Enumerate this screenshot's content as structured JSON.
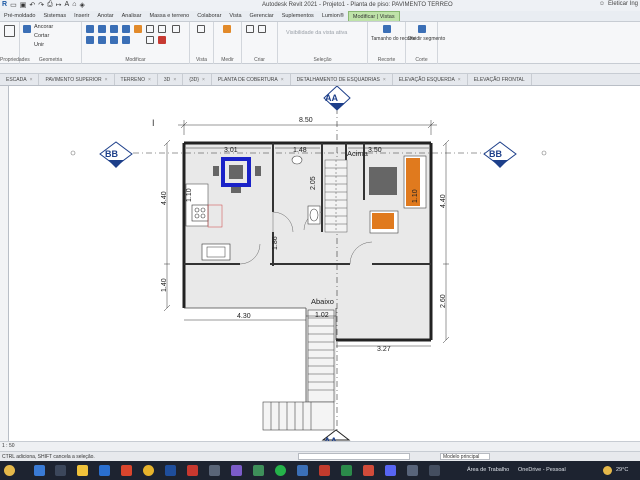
{
  "titlebar": {
    "title": "Autodesk Revit 2021 - Projeto1 - Planta de piso: PAVIMENTO TERREO",
    "user": "Eleticar Ing"
  },
  "ribbon_tabs": [
    "Pré-moldado",
    "Sistemas",
    "Inserir",
    "Anotar",
    "Analisar",
    "Massa e terreno",
    "Colaborar",
    "Vista",
    "Gerenciar",
    "Suplementos",
    "Lumion®",
    "Modificar | Vistas"
  ],
  "ribbon": {
    "propriedades": "Propriedades",
    "area_transferencia": "Área de transferência",
    "geometria": "Geometria",
    "modificar": "Modificar",
    "vista": "Vista",
    "medir": "Medir",
    "criar": "Criar",
    "selecao": "Seleção",
    "recorte": "Recorte",
    "corte": "Corte",
    "tools": {
      "ancorar": "Ancorar",
      "cortar": "Cortar",
      "unir": "Unir",
      "tamanho_recorte": "Tamanho do recorte",
      "dividir_segmento": "Dividir segmento",
      "visibilidade": "Visibilidade da vista ativa"
    }
  },
  "view_tabs": [
    {
      "label": "ESCADA",
      "active": false
    },
    {
      "label": "PAVIMENTO SUPERIOR",
      "active": false
    },
    {
      "label": "TERRENO",
      "active": false
    },
    {
      "label": "3D",
      "active": false
    },
    {
      "label": "{3D}",
      "active": false
    },
    {
      "label": "PLANTA DE COBERTURA",
      "active": false
    },
    {
      "label": "DETALHAMENTO DE ESQUADRIAS",
      "active": false
    },
    {
      "label": "ELEVAÇÃO ESQUERDA",
      "active": false
    },
    {
      "label": "ELEVAÇÃO FRONTAL",
      "active": false
    }
  ],
  "drawing": {
    "section_top": "AA",
    "section_bottom": "AA",
    "section_left": "BB",
    "section_right": "BB",
    "dims": {
      "overall_width": "8.50",
      "left_room_width": "3.01",
      "mid_room_width": "1.48",
      "right_room_width": "3.50",
      "left_height_top": "4.40",
      "left_height_bottom": "1.40",
      "right_height_top": "4.40",
      "right_height_bottom": "2.60",
      "bottom_left_width": "4.30",
      "bottom_right_width": "3.27",
      "stair_width": "1.02",
      "kitchen_vertical": "1.10",
      "bath_vertical": "2.05",
      "door_left": "1.86",
      "bed_vertical": "1.10"
    },
    "labels": {
      "acima": "Acima",
      "abaixo": "Abaixo"
    }
  },
  "viewbar": {
    "scale": "1 : 50"
  },
  "statusbar": {
    "message": "CTRL adiciona, SHIFT cancela a seleção.",
    "model": "Modelo principal"
  },
  "taskbar": {
    "desktop_label": "Área de Trabalho",
    "onedrive": "OneDrive - Pessoal",
    "temperature": "29°C"
  },
  "colors": {
    "tag_blue": "#1d3f8a",
    "ribbon_active": "#bfe3a9",
    "taskbar_bg": "#1d2330",
    "selected_table_blue": "#1a22c8",
    "bed_orange": "#e07a1e"
  }
}
